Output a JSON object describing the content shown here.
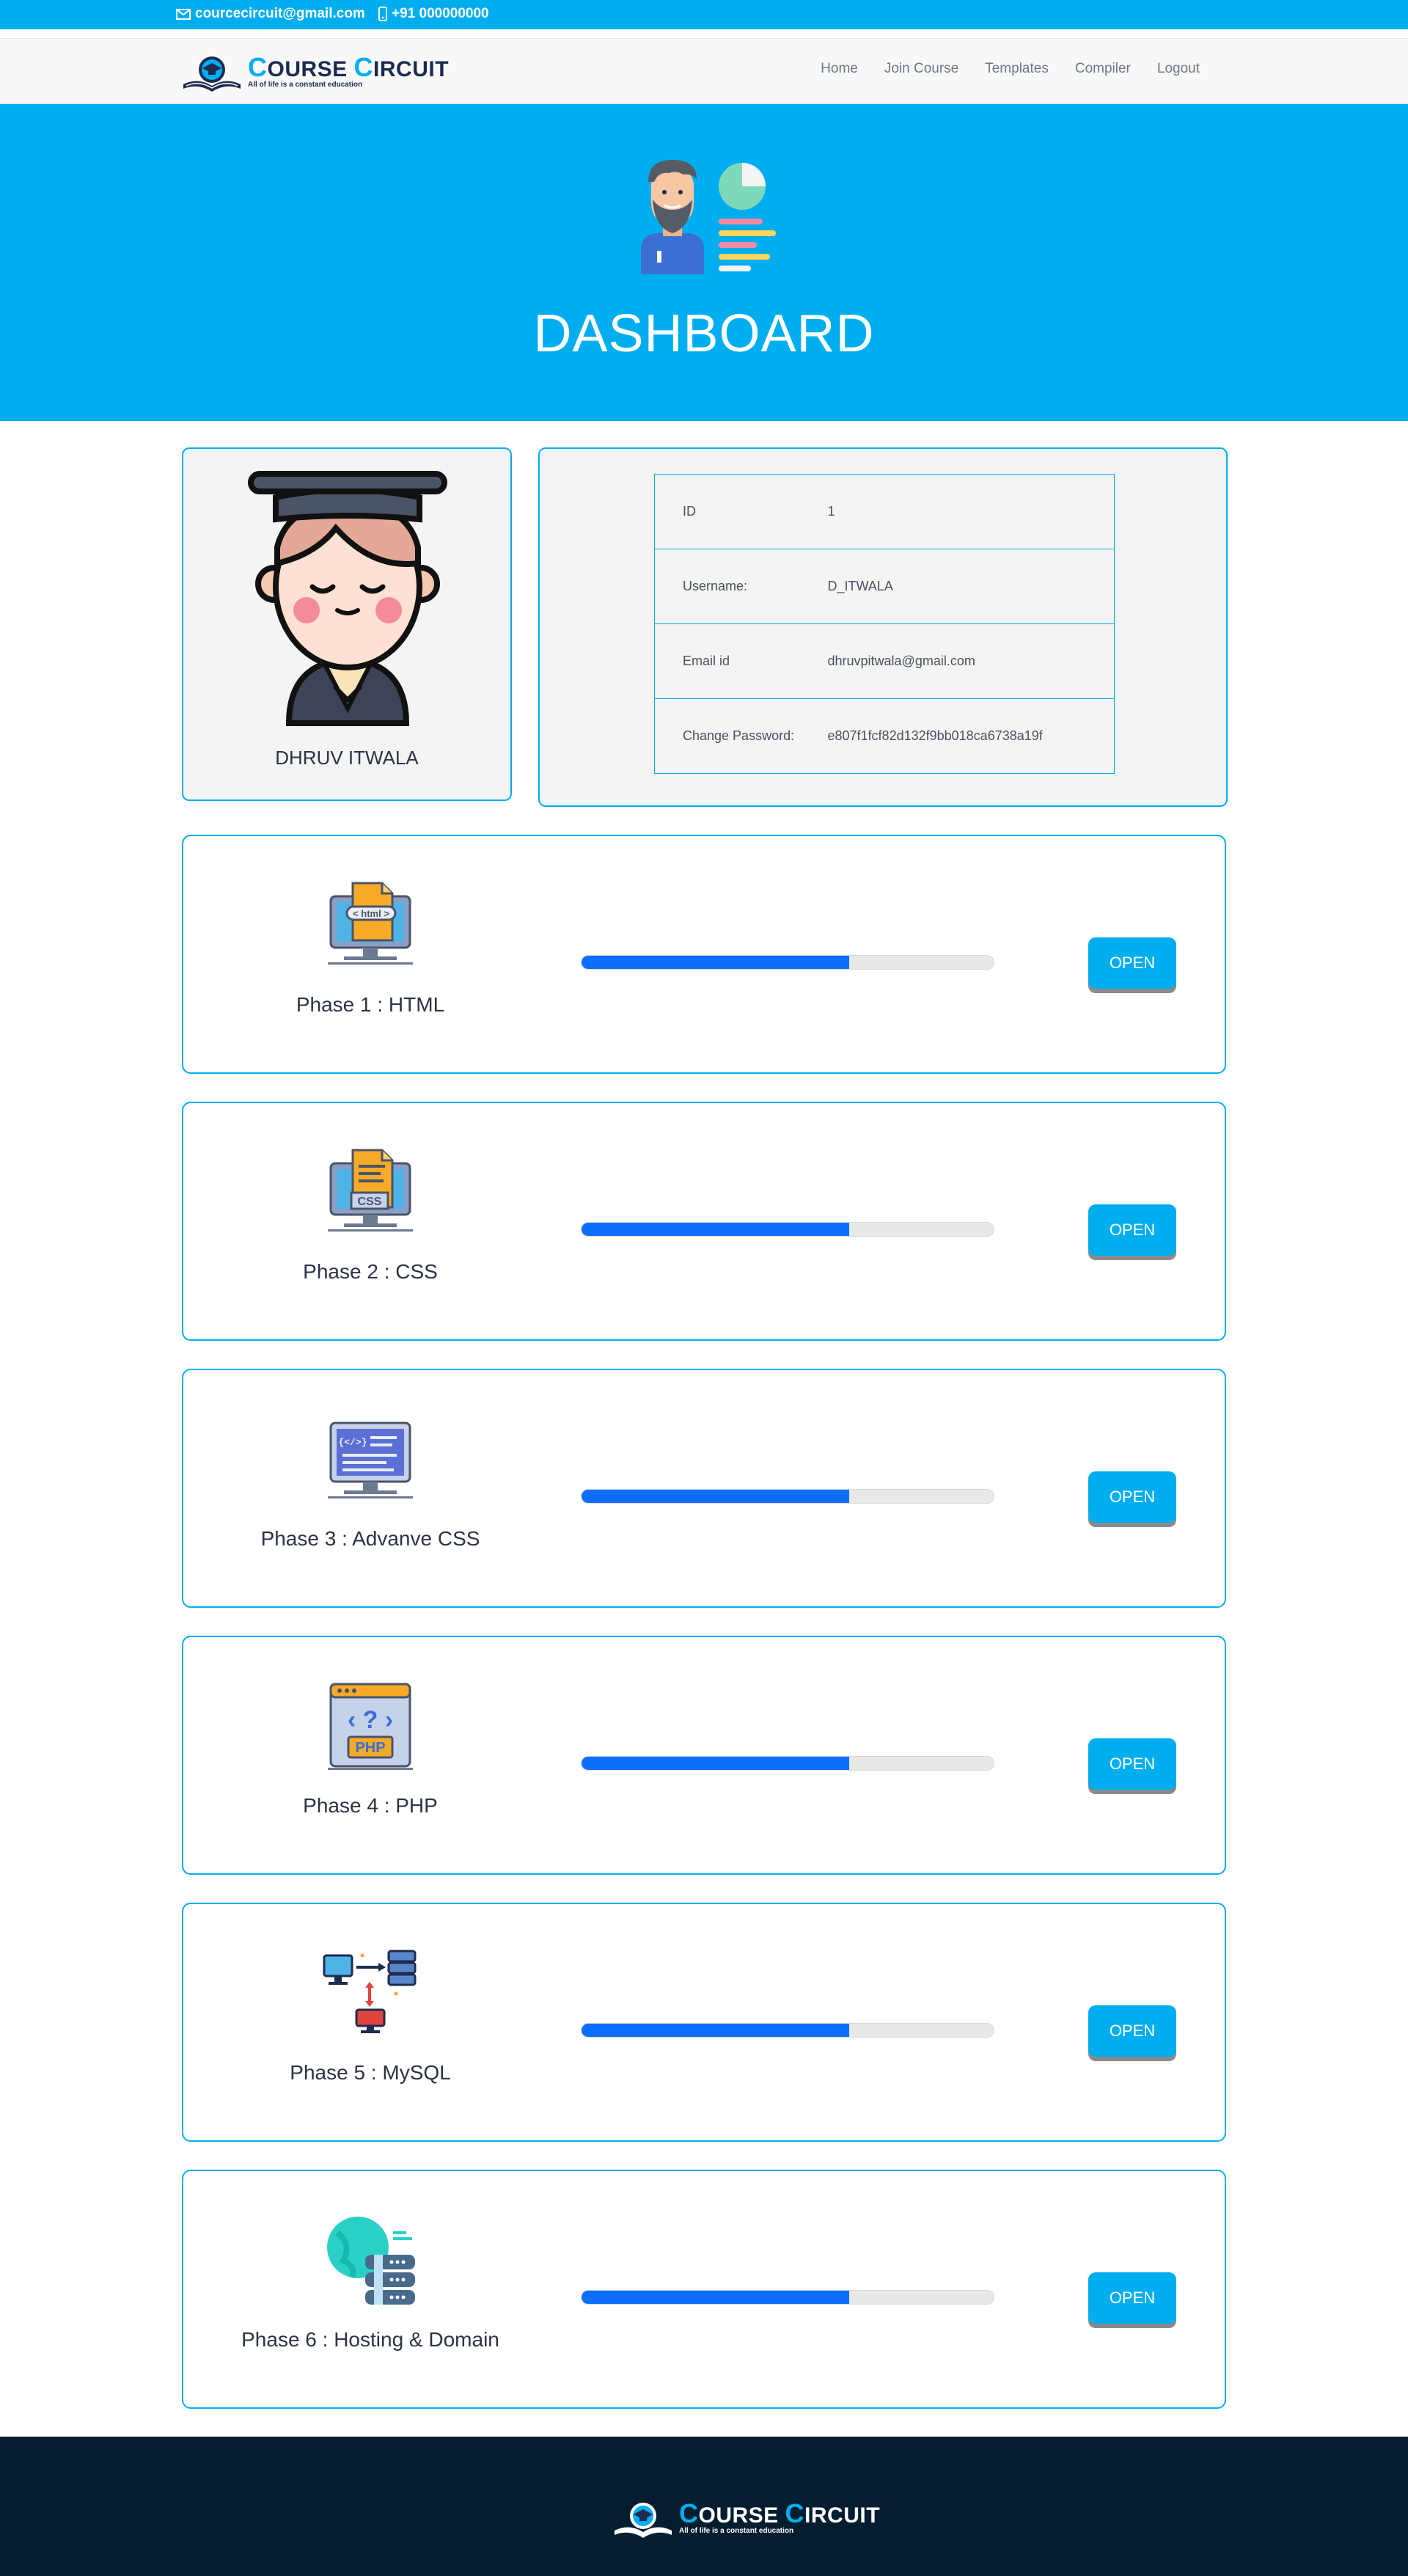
{
  "contact": {
    "email": "courcecircuit@gmail.com",
    "phone": "+91 000000000"
  },
  "brand": {
    "title_first": "C",
    "title_rest_1": "OURSE ",
    "title_second": "C",
    "title_rest_2": "IRCUIT",
    "tagline": "All of life is a constant education"
  },
  "nav": {
    "items": [
      "Home",
      "Join Course",
      "Templates",
      "Compiler",
      "Logout"
    ]
  },
  "hero": {
    "title": "DASHBOARD"
  },
  "profile": {
    "name": "DHRUV ITWALA"
  },
  "info": {
    "rows": [
      {
        "key": "ID",
        "value": "1"
      },
      {
        "key": "Username:",
        "value": "D_ITWALA"
      },
      {
        "key": "Email id",
        "value": "dhruvpitwala@gmail.com"
      },
      {
        "key": "Change Password:",
        "value": "e807f1fcf82d132f9bb018ca6738a19f"
      }
    ]
  },
  "phases": [
    {
      "label": "Phase 1 : HTML",
      "icon": "html-monitor-icon",
      "progress": 0.65,
      "button": "OPEN"
    },
    {
      "label": "Phase 2 : CSS",
      "icon": "css-monitor-icon",
      "progress": 0.65,
      "button": "OPEN"
    },
    {
      "label": "Phase 3 : Advanve CSS",
      "icon": "code-monitor-icon",
      "progress": 0.65,
      "button": "OPEN"
    },
    {
      "label": "Phase 4 : PHP",
      "icon": "php-window-icon",
      "progress": 0.65,
      "button": "OPEN"
    },
    {
      "label": "Phase 5 : MySQL",
      "icon": "database-network-icon",
      "progress": 0.65,
      "button": "OPEN"
    },
    {
      "label": "Phase 6 : Hosting & Domain",
      "icon": "globe-server-icon",
      "progress": 0.65,
      "button": "OPEN"
    }
  ],
  "colors": {
    "primary": "#00aeef",
    "progress": "#0d6efd",
    "footer": "#041e2f"
  }
}
